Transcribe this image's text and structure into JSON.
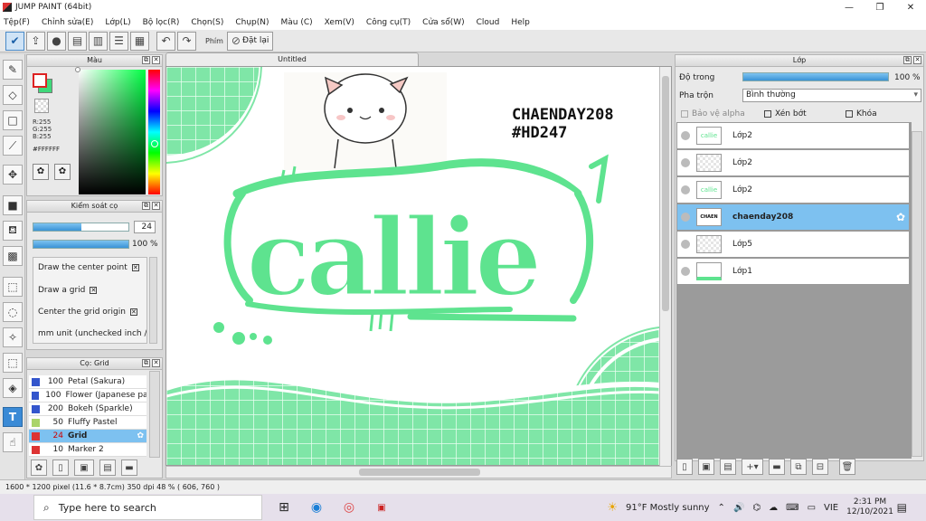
{
  "app": {
    "title": "JUMP PAINT (64bit)"
  },
  "menu": [
    "Tệp(F)",
    "Chỉnh sửa(E)",
    "Lớp(L)",
    "Bộ lọc(R)",
    "Chọn(S)",
    "Chụp(N)",
    "Màu (C)",
    "Xem(V)",
    "Công cụ(T)",
    "Cửa sổ(W)",
    "Cloud",
    "Help"
  ],
  "toolbar": {
    "phim_label": "Phím",
    "reset_label": "Đặt lại"
  },
  "color_panel": {
    "title": "Màu",
    "r": "R:255",
    "g": "G:255",
    "b": "B:255",
    "hex": "#FFFFFF"
  },
  "brush_control": {
    "title": "Kiểm soát cọ",
    "size": "24",
    "opacity": "100 %",
    "size_level": 0.5,
    "opacity_level": 1.0,
    "options": [
      "Draw the center point",
      "Draw a grid",
      "Center the grid origin",
      "mm unit (unchecked inch / 1"
    ]
  },
  "brush_list": {
    "title": "Cọ: Grid",
    "items": [
      {
        "size": "100",
        "name": "Petal (Sakura)",
        "color": "#3355cc"
      },
      {
        "size": "100",
        "name": "Flower (Japanese patt",
        "color": "#3355cc"
      },
      {
        "size": "200",
        "name": "Bokeh (Sparkle)",
        "color": "#3355cc"
      },
      {
        "size": "50",
        "name": "Fluffy Pastel",
        "color": "#aad46a"
      },
      {
        "size": "24",
        "name": "Grid",
        "color": "#dd3333"
      },
      {
        "size": "10",
        "name": "Marker 2",
        "color": "#dd3333"
      }
    ]
  },
  "canvas": {
    "tab": "Untitled",
    "watermark_line1": "CHAENDAY208",
    "watermark_line2": "#HD247",
    "art_text": "callie",
    "accent": "#5ee38f"
  },
  "layer_panel": {
    "title": "Lớp",
    "opacity_label": "Độ trong",
    "opacity_value": "100 %",
    "opacity_level": 1.0,
    "blend_label": "Pha trộn",
    "blend_value": "Bình thường",
    "protect_alpha": "Bảo vệ alpha",
    "clip": "Xén bớt",
    "lock": "Khóa",
    "layers": [
      {
        "name": "Lớp2",
        "thumb": "callie"
      },
      {
        "name": "Lớp2",
        "thumb": ""
      },
      {
        "name": "Lớp2",
        "thumb": "callie"
      },
      {
        "name": "chaenday208",
        "thumb": "CHAEN"
      },
      {
        "name": "Lớp5",
        "thumb": ""
      },
      {
        "name": "Lớp1",
        "thumb": ""
      }
    ]
  },
  "status": {
    "text": "1600 * 1200 pixel  (11.6 * 8.7cm)  350 dpi  48 %  ( 606, 760 )"
  },
  "taskbar": {
    "search_placeholder": "Type here to search",
    "weather": "91°F  Mostly sunny",
    "lang": "VIE",
    "time": "2:31 PM",
    "date": "12/10/2021"
  }
}
